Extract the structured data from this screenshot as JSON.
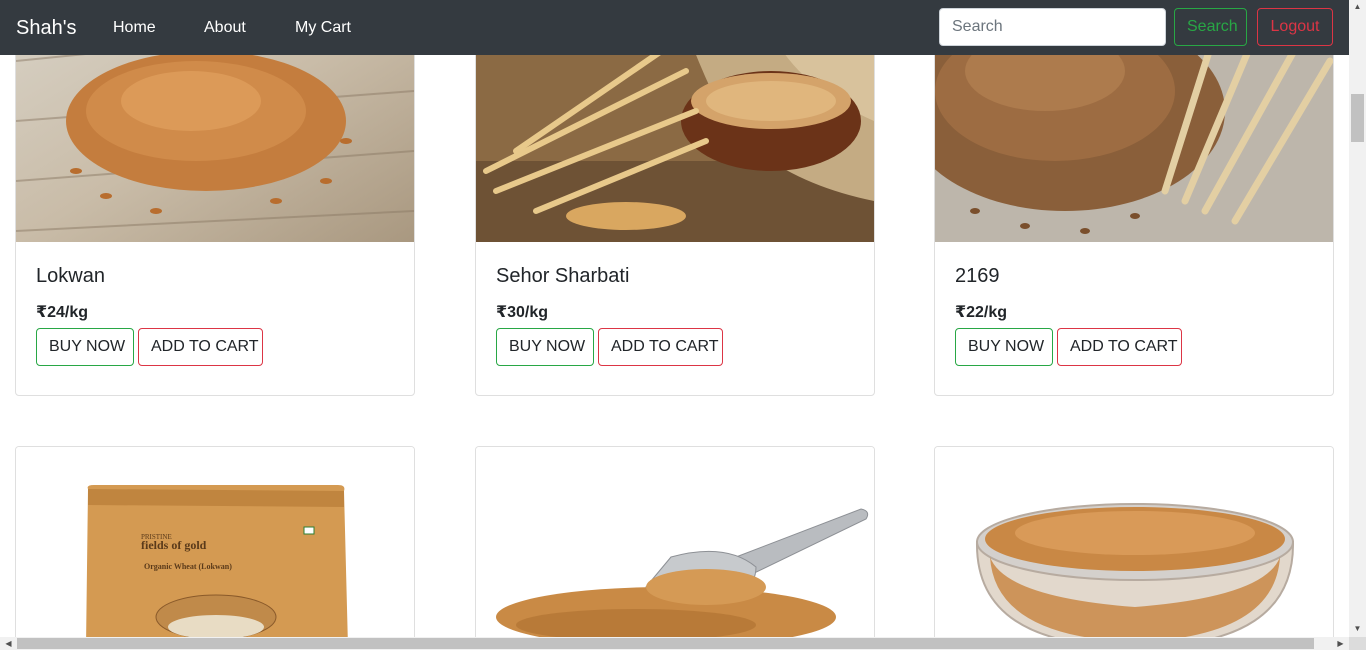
{
  "navbar": {
    "brand": "Shah's",
    "links": [
      "Home",
      "About",
      "My Cart"
    ],
    "search_placeholder": "Search",
    "search_button": "Search",
    "logout_button": "Logout"
  },
  "products": [
    {
      "name": "Lokwan",
      "price": "₹24/kg",
      "buy_label": "BUY NOW",
      "cart_label": "ADD TO CART",
      "image": "wheat-grains-on-wood"
    },
    {
      "name": "Sehor Sharbati",
      "price": "₹30/kg",
      "buy_label": "BUY NOW",
      "cart_label": "ADD TO CART",
      "image": "wheat-bowl-with-ears"
    },
    {
      "name": "2169",
      "price": "₹22/kg",
      "buy_label": "BUY NOW",
      "cart_label": "ADD TO CART",
      "image": "wheat-pile-with-ears"
    },
    {
      "image": "fields-of-gold-package",
      "package_text": {
        "brand_small": "PRISTINE",
        "brand": "fields of gold",
        "product": "Organic Wheat (Lokwan)"
      }
    },
    {
      "image": "wheat-scoop"
    },
    {
      "image": "wheat-glass-bowl"
    }
  ],
  "colors": {
    "navbar": "#343a40",
    "success": "#28a745",
    "danger": "#dc3545"
  }
}
